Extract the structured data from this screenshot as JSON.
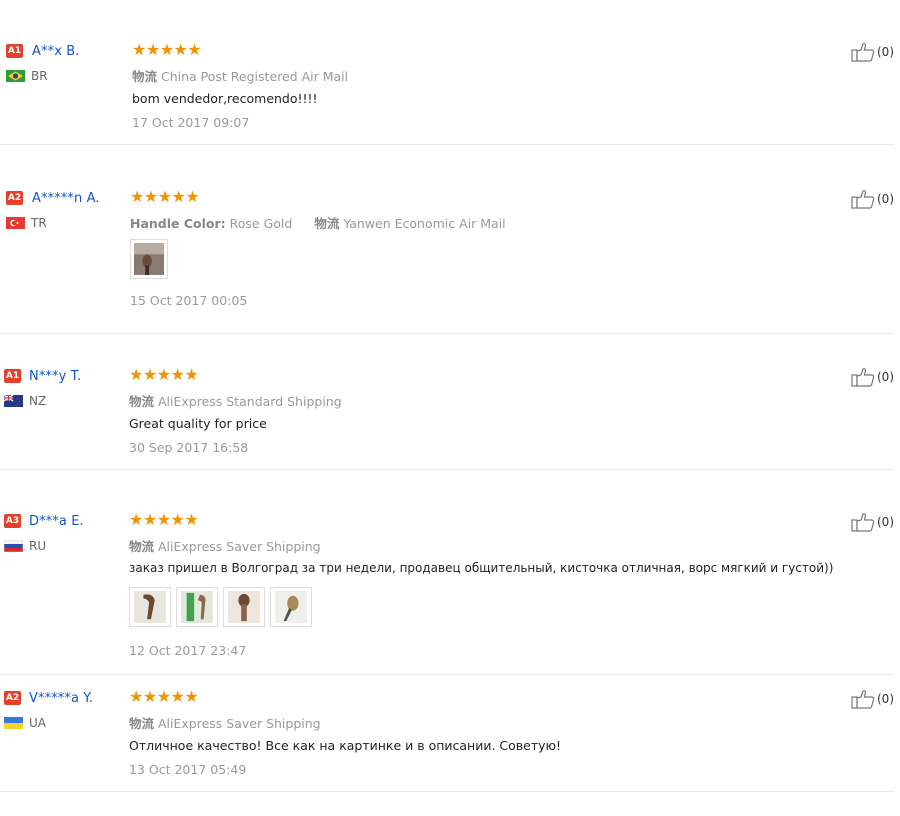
{
  "reviews": [
    {
      "badge": "A1",
      "name": "A**x B.",
      "country": "BR",
      "stars": "★★★★★",
      "meta": [
        {
          "key": "物流",
          "value": "China Post Registered Air Mail"
        }
      ],
      "text": "bom vendedor,recomendo!!!!",
      "images": [],
      "date": "17 Oct 2017 09:07",
      "likes": "(0)"
    },
    {
      "badge": "A2",
      "name": "A*****n A.",
      "country": "TR",
      "stars": "★★★★★",
      "meta": [
        {
          "key": "Handle Color:",
          "value": "Rose Gold"
        },
        {
          "key": "物流",
          "value": "Yanwen Economic Air Mail"
        }
      ],
      "text": "",
      "images": [
        "review-photo-brush"
      ],
      "date": "15 Oct 2017 00:05",
      "likes": "(0)"
    },
    {
      "badge": "A1",
      "name": "N***y T.",
      "country": "NZ",
      "stars": "★★★★★",
      "meta": [
        {
          "key": "物流",
          "value": "AliExpress Standard Shipping"
        }
      ],
      "text": "Great quality for price",
      "images": [],
      "date": "30 Sep 2017 16:58",
      "likes": "(0)"
    },
    {
      "badge": "A3",
      "name": "D***a E.",
      "country": "RU",
      "stars": "★★★★★",
      "meta": [
        {
          "key": "物流",
          "value": "AliExpress Saver Shipping"
        }
      ],
      "text": "заказ пришел в Волгоград за три недели, продавец общительный, кисточка отличная, ворс мягкий и густой))",
      "images": [
        "review-photo-1",
        "review-photo-2",
        "review-photo-3",
        "review-photo-4"
      ],
      "date": "12 Oct 2017 23:47",
      "likes": "(0)"
    },
    {
      "badge": "A2",
      "name": "V*****a Y.",
      "country": "UA",
      "stars": "★★★★★",
      "meta": [
        {
          "key": "物流",
          "value": "AliExpress Saver Shipping"
        }
      ],
      "text": "Отличное качество! Все как на картинке и в описании. Советую!",
      "images": [],
      "date": "13 Oct 2017 05:49",
      "likes": "(0)"
    }
  ],
  "icons": {
    "like": "thumbs-up-icon",
    "star": "star-icon"
  },
  "colors": {
    "badge": "#e4402a",
    "name": "#1155cc",
    "star": "#f29300"
  }
}
